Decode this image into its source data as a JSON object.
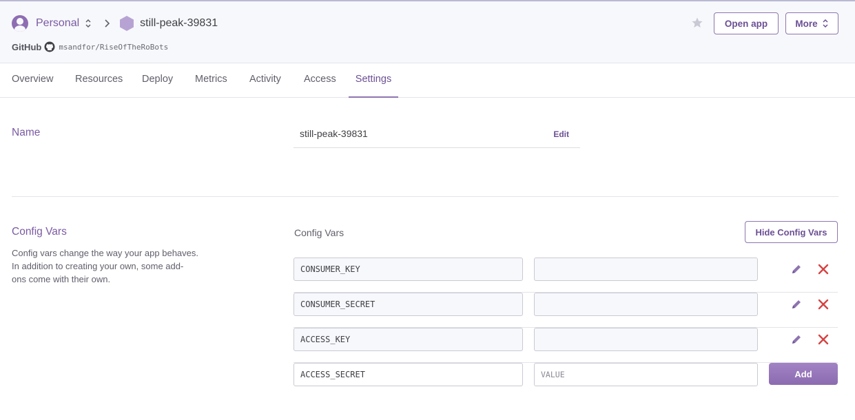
{
  "header": {
    "account_label": "Personal",
    "app_name": "still-peak-39831",
    "github_label": "GitHub",
    "github_repo": "msandfor/RiseOfTheRoBots",
    "open_app_label": "Open app",
    "more_label": "More"
  },
  "tabs": [
    {
      "label": "Overview",
      "active": false
    },
    {
      "label": "Resources",
      "active": false
    },
    {
      "label": "Deploy",
      "active": false
    },
    {
      "label": "Metrics",
      "active": false
    },
    {
      "label": "Activity",
      "active": false
    },
    {
      "label": "Access",
      "active": false
    },
    {
      "label": "Settings",
      "active": true
    }
  ],
  "name_section": {
    "title": "Name",
    "value": "still-peak-39831",
    "edit_label": "Edit"
  },
  "config_section": {
    "title": "Config Vars",
    "description": "Config vars change the way your app behaves. In addition to creating your own, some add-ons come with their own.",
    "desc_lines": [
      "Config vars change the way your app behaves.",
      "In addition to creating your own, some add-",
      "ons come with their own."
    ],
    "table_label": "Config Vars",
    "hide_button_label": "Hide Config Vars",
    "vars": [
      {
        "key": "CONSUMER_KEY",
        "value": ""
      },
      {
        "key": "CONSUMER_SECRET",
        "value": ""
      },
      {
        "key": "ACCESS_KEY",
        "value": ""
      }
    ],
    "new_var": {
      "key": "ACCESS_SECRET",
      "value_placeholder": "VALUE",
      "add_label": "Add"
    }
  },
  "colors": {
    "accent": "#7a5aa3",
    "delete": "#d64242",
    "add_button": "#9a7bbf"
  },
  "icons": [
    "avatar-icon",
    "updown-icon",
    "chevron-right-icon",
    "app-hexagon-icon",
    "github-icon",
    "star-icon",
    "pencil-icon",
    "close-icon"
  ]
}
